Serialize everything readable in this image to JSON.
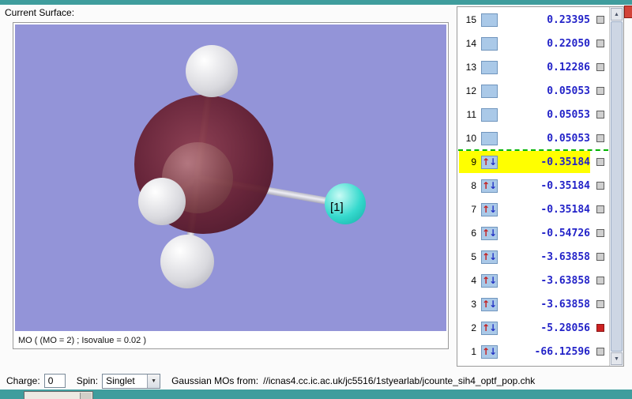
{
  "titles": {
    "surface_label": "Current Surface:",
    "mo_caption": "MO ( (MO = 2) ; Isovalue = 0.02 )"
  },
  "molecule": {
    "atom_label": "[1]"
  },
  "mo_list": {
    "up_arrow": "↑",
    "down_arrow": "↓",
    "rows": [
      {
        "n": 15,
        "energy": "0.23395",
        "occupied": false,
        "highlight": false,
        "current": false
      },
      {
        "n": 14,
        "energy": "0.22050",
        "occupied": false,
        "highlight": false,
        "current": false
      },
      {
        "n": 13,
        "energy": "0.12286",
        "occupied": false,
        "highlight": false,
        "current": false
      },
      {
        "n": 12,
        "energy": "0.05053",
        "occupied": false,
        "highlight": false,
        "current": false
      },
      {
        "n": 11,
        "energy": "0.05053",
        "occupied": false,
        "highlight": false,
        "current": false
      },
      {
        "n": 10,
        "energy": "0.05053",
        "occupied": false,
        "highlight": false,
        "current": false
      },
      {
        "n": 9,
        "energy": "-0.35184",
        "occupied": true,
        "highlight": true,
        "current": false,
        "homo_separator": true
      },
      {
        "n": 8,
        "energy": "-0.35184",
        "occupied": true,
        "highlight": false,
        "current": false
      },
      {
        "n": 7,
        "energy": "-0.35184",
        "occupied": true,
        "highlight": false,
        "current": false
      },
      {
        "n": 6,
        "energy": "-0.54726",
        "occupied": true,
        "highlight": false,
        "current": false
      },
      {
        "n": 5,
        "energy": "-3.63858",
        "occupied": true,
        "highlight": false,
        "current": false
      },
      {
        "n": 4,
        "energy": "-3.63858",
        "occupied": true,
        "highlight": false,
        "current": false
      },
      {
        "n": 3,
        "energy": "-3.63858",
        "occupied": true,
        "highlight": false,
        "current": false
      },
      {
        "n": 2,
        "energy": "-5.28056",
        "occupied": true,
        "highlight": false,
        "current": true
      },
      {
        "n": 1,
        "energy": "-66.12596",
        "occupied": true,
        "highlight": false,
        "current": false
      }
    ]
  },
  "footer": {
    "charge_label": "Charge:",
    "charge_value": "0",
    "spin_label": "Spin:",
    "spin_value": "Singlet",
    "source_label": "Gaussian MOs from:",
    "source_path": "//icnas4.cc.ic.ac.uk/jc5516/1styearlab/jcounte_sih4_optf_pop.chk"
  },
  "colors": {
    "highlight": "#ffff00",
    "energy_text": "#2323c8",
    "current_marker": "#cc2222",
    "separator": "#00b400",
    "viewport_bg": "#9394d8",
    "desktop_teal": "#3f9d9d"
  }
}
